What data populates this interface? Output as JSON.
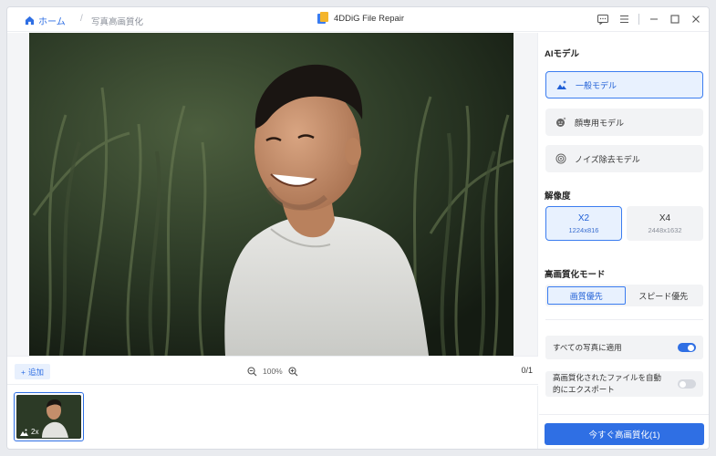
{
  "titlebar": {
    "home_label": "ホーム",
    "separator": "/",
    "current_page": "写真高画質化",
    "app_title": "4DDiG File Repair"
  },
  "preview": {
    "add_label": "追加",
    "zoom_level": "100%",
    "page_count": "0/1"
  },
  "thumbnails": [
    {
      "badge": "2x"
    }
  ],
  "sidebar": {
    "ai_model_title": "AIモデル",
    "models": [
      {
        "label": "一般モデル",
        "icon": "landscape-sparkle-icon",
        "active": true
      },
      {
        "label": "顔専用モデル",
        "icon": "face-sparkle-icon",
        "active": false
      },
      {
        "label": "ノイズ除去モデル",
        "icon": "denoise-icon",
        "active": false
      }
    ],
    "resolution_title": "解像度",
    "resolutions": [
      {
        "label": "X2",
        "size": "1224x816",
        "active": true
      },
      {
        "label": "X4",
        "size": "2448x1632",
        "active": false
      }
    ],
    "mode_title": "高画質化モード",
    "modes": [
      {
        "label": "画質優先",
        "active": true
      },
      {
        "label": "スピード優先",
        "active": false
      }
    ],
    "apply_all_label": "すべての写真に適用",
    "apply_all_on": true,
    "auto_export_label": "高画質化されたファイルを自動的にエクスポート",
    "auto_export_on": false,
    "enhance_button": "今すぐ高画質化(1)"
  },
  "colors": {
    "accent": "#2f6fe4",
    "active_bg": "#e8f1fe",
    "card_bg": "#f2f3f5"
  }
}
